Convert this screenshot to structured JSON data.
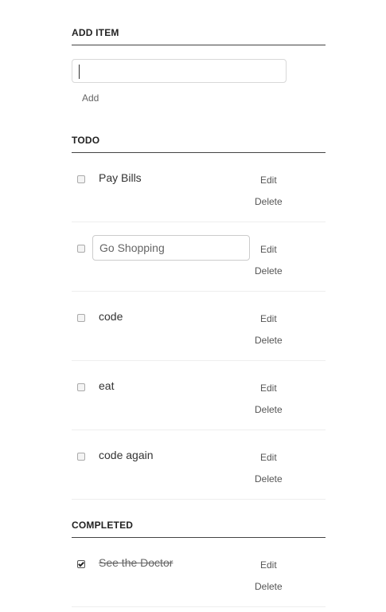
{
  "add_section": {
    "title": "ADD ITEM",
    "input_value": "",
    "add_label": "Add"
  },
  "todo_section": {
    "title": "TODO",
    "items": [
      {
        "text": "Pay Bills",
        "editing": false,
        "checked": false
      },
      {
        "text": "Go Shopping",
        "editing": true,
        "checked": false
      },
      {
        "text": "code",
        "editing": false,
        "checked": false
      },
      {
        "text": "eat",
        "editing": false,
        "checked": false
      },
      {
        "text": "code again",
        "editing": false,
        "checked": false
      }
    ]
  },
  "completed_section": {
    "title": "COMPLETED",
    "items": [
      {
        "text": "See the Doctor",
        "editing": false,
        "checked": true
      }
    ]
  },
  "actions": {
    "edit_label": "Edit",
    "delete_label": "Delete"
  }
}
